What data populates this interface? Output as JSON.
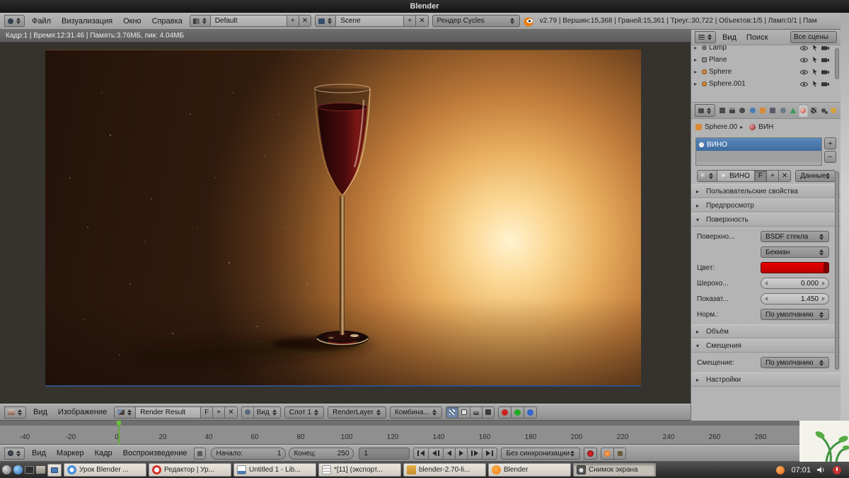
{
  "glyphs": {
    "plus": "+",
    "minus": "−",
    "close": "✕",
    "fake_user": "F",
    "tri_right": "▸",
    "tri_down": "▾",
    "chevron": "▸"
  },
  "titlebar": {
    "title": "Blender"
  },
  "menubar": {
    "menus": [
      "Файл",
      "Визуализация",
      "Окно",
      "Справка"
    ],
    "layout_value": "Default",
    "scene_value": "Scene",
    "engine_value": "Рендер Cycles",
    "stats": "v2.79 | Вершин:15,368 | Граней:15,361 | Треуг.:30,722 | Объектов:1/5 | Ламп:0/1 | Пам"
  },
  "infobar": {
    "text": "Кадр:1 | Время:12:31.46 | Память:3.76МБ, пик: 4.04МБ"
  },
  "outliner": {
    "menus": [
      "Вид",
      "Поиск"
    ],
    "scope": "Все сцены",
    "items": [
      "Lamp",
      "Plane",
      "Sphere",
      "Sphere.001"
    ]
  },
  "properties": {
    "breadcrumb": {
      "object": "Sphere.00",
      "material": "ВИН"
    },
    "slot_name": "ВИНО",
    "name_value": "ВИНО",
    "data_button": "Данные",
    "panels": {
      "custom": "Пользовательские свойства",
      "preview": "Предпросмотр",
      "surface": "Поверхность",
      "volume": "Объём",
      "displacement": "Смещения",
      "settings": "Настройки"
    },
    "surface": {
      "surface_label": "Поверхно...",
      "surface_value": "BSDF стекла",
      "distribution": "Бекман",
      "color_label": "Цвет:",
      "rough_label": "Шерохо...",
      "rough_value": "0.000",
      "ior_label": "Показат...",
      "ior_value": "1.450",
      "normal_label": "Норм.:",
      "normal_value": "По умолчанию"
    },
    "displacement": {
      "label": "Смещение:",
      "value": "По умолчанию"
    }
  },
  "image_editor": {
    "menus": [
      "Вид",
      "Изображение"
    ],
    "image_value": "Render Result",
    "view_value": "Вид",
    "slot_value": "Слот 1",
    "layer_value": "RenderLayer",
    "pass_value": "Комбина..."
  },
  "timeline": {
    "menus": [
      "Вид",
      "Маркер",
      "Кадр",
      "Воспроизведение"
    ],
    "start_label": "Начало:",
    "start_value": "1",
    "end_label": "Конец:",
    "end_value": "250",
    "frame_value": "1",
    "sync_value": "Без синхронизации",
    "ticks": [
      "-40",
      "-20",
      "0",
      "20",
      "40",
      "60",
      "80",
      "100",
      "120",
      "140",
      "160",
      "180",
      "200",
      "220",
      "240",
      "260",
      "280"
    ],
    "playhead_frame": "1"
  },
  "taskbar": {
    "windows": [
      "Урок Blender ...",
      "Редактор | Ур...",
      "Untitled 1 - Lib...",
      "*[11] (экспорт...",
      "blender-2.70-li...",
      "Blender",
      "Снимок экрана"
    ],
    "clock": "07:01"
  },
  "colors": {
    "selection_blue": "#3d6ca0",
    "material_red": "#d40000",
    "playhead_green": "#5fae33",
    "wine_red": "#5a0f10"
  }
}
